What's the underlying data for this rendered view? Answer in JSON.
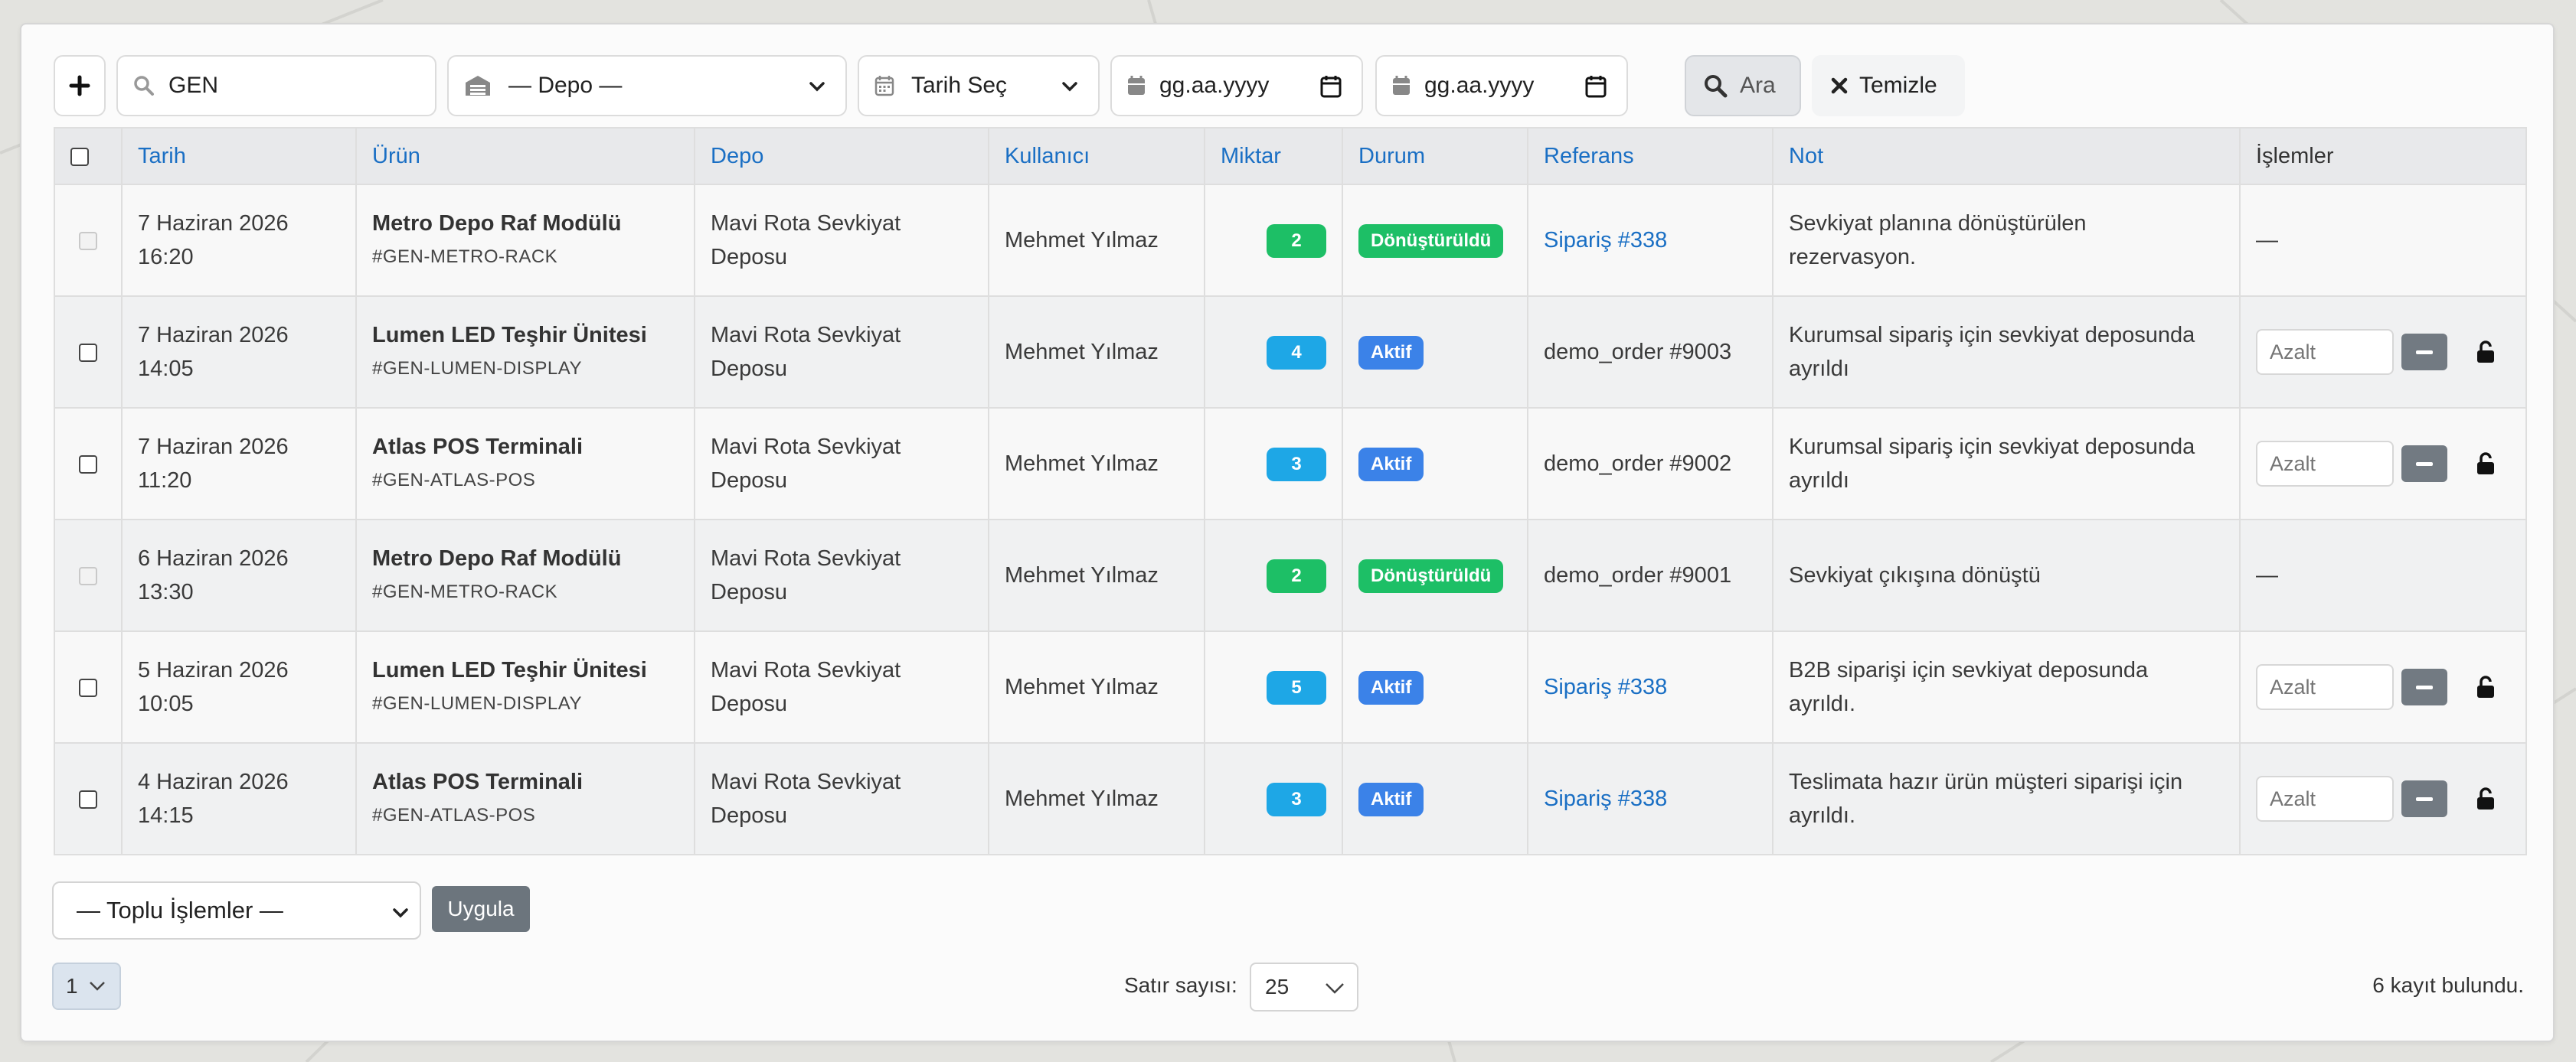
{
  "toolbar": {
    "add_icon": "plus-icon",
    "search_value": "GEN",
    "depo_placeholder": "— Depo —",
    "date_pick_label": "Tarih Seç",
    "date_from_placeholder": "gg.aa.yyyy",
    "date_to_placeholder": "gg.aa.yyyy",
    "search_button": "Ara",
    "clear_button": "Temizle"
  },
  "table": {
    "headers": {
      "tarih": "Tarih",
      "urun": "Ürün",
      "depo": "Depo",
      "kullanici": "Kullanıcı",
      "miktar": "Miktar",
      "durum": "Durum",
      "referans": "Referans",
      "not": "Not",
      "islemler": "İşlemler"
    },
    "rows": [
      {
        "date": "7 Haziran 2026",
        "time": "16:20",
        "product": "Metro Depo Raf Modülü",
        "sku": "#GEN-METRO-RACK",
        "depo1": "Mavi Rota Sevkiyat",
        "depo2": "Deposu",
        "user": "Mehmet Yılmaz",
        "qty": "2",
        "status": "Dönüştürüldü",
        "ref": "Sipariş #338",
        "note1": "Sevkiyat planına dönüştürülen",
        "note2": "rezervasyon.",
        "ops": "—"
      },
      {
        "date": "7 Haziran 2026",
        "time": "14:05",
        "product": "Lumen LED Teşhir Ünitesi",
        "sku": "#GEN-LUMEN-DISPLAY",
        "depo1": "Mavi Rota Sevkiyat",
        "depo2": "Deposu",
        "user": "Mehmet Yılmaz",
        "qty": "4",
        "status": "Aktif",
        "ref": "demo_order #9003",
        "note1": "Kurumsal sipariş için sevkiyat deposunda",
        "note2": "ayrıldı",
        "ops_placeholder": "Azalt"
      },
      {
        "date": "7 Haziran 2026",
        "time": "11:20",
        "product": "Atlas POS Terminali",
        "sku": "#GEN-ATLAS-POS",
        "depo1": "Mavi Rota Sevkiyat",
        "depo2": "Deposu",
        "user": "Mehmet Yılmaz",
        "qty": "3",
        "status": "Aktif",
        "ref": "demo_order #9002",
        "note1": "Kurumsal sipariş için sevkiyat deposunda",
        "note2": "ayrıldı",
        "ops_placeholder": "Azalt"
      },
      {
        "date": "6 Haziran 2026",
        "time": "13:30",
        "product": "Metro Depo Raf Modülü",
        "sku": "#GEN-METRO-RACK",
        "depo1": "Mavi Rota Sevkiyat",
        "depo2": "Deposu",
        "user": "Mehmet Yılmaz",
        "qty": "2",
        "status": "Dönüştürüldü",
        "ref": "demo_order #9001",
        "note1": "Sevkiyat çıkışına dönüştü",
        "note2": "",
        "ops": "—"
      },
      {
        "date": "5 Haziran 2026",
        "time": "10:05",
        "product": "Lumen LED Teşhir Ünitesi",
        "sku": "#GEN-LUMEN-DISPLAY",
        "depo1": "Mavi Rota Sevkiyat",
        "depo2": "Deposu",
        "user": "Mehmet Yılmaz",
        "qty": "5",
        "status": "Aktif",
        "ref": "Sipariş #338",
        "note1": "B2B siparişi için sevkiyat deposunda",
        "note2": "ayrıldı.",
        "ops_placeholder": "Azalt"
      },
      {
        "date": "4 Haziran 2026",
        "time": "14:15",
        "product": "Atlas POS Terminali",
        "sku": "#GEN-ATLAS-POS",
        "depo1": "Mavi Rota Sevkiyat",
        "depo2": "Deposu",
        "user": "Mehmet Yılmaz",
        "qty": "3",
        "status": "Aktif",
        "ref": "Sipariş #338",
        "note1": "Teslimata hazır ürün müşteri siparişi için",
        "note2": "ayrıldı.",
        "ops_placeholder": "Azalt"
      }
    ]
  },
  "footer": {
    "bulk_actions": "— Toplu İşlemler —",
    "apply_button": "Uygula",
    "page": "1",
    "rows_label": "Satır sayısı:",
    "rows_value": "25",
    "count_text": "6 kayıt bulundu."
  },
  "colors": {
    "link": "#1a6fc4",
    "active_badge": "#3b82e8",
    "converted_badge": "#1dbf66",
    "qty_badge": "#1ea7e6"
  }
}
